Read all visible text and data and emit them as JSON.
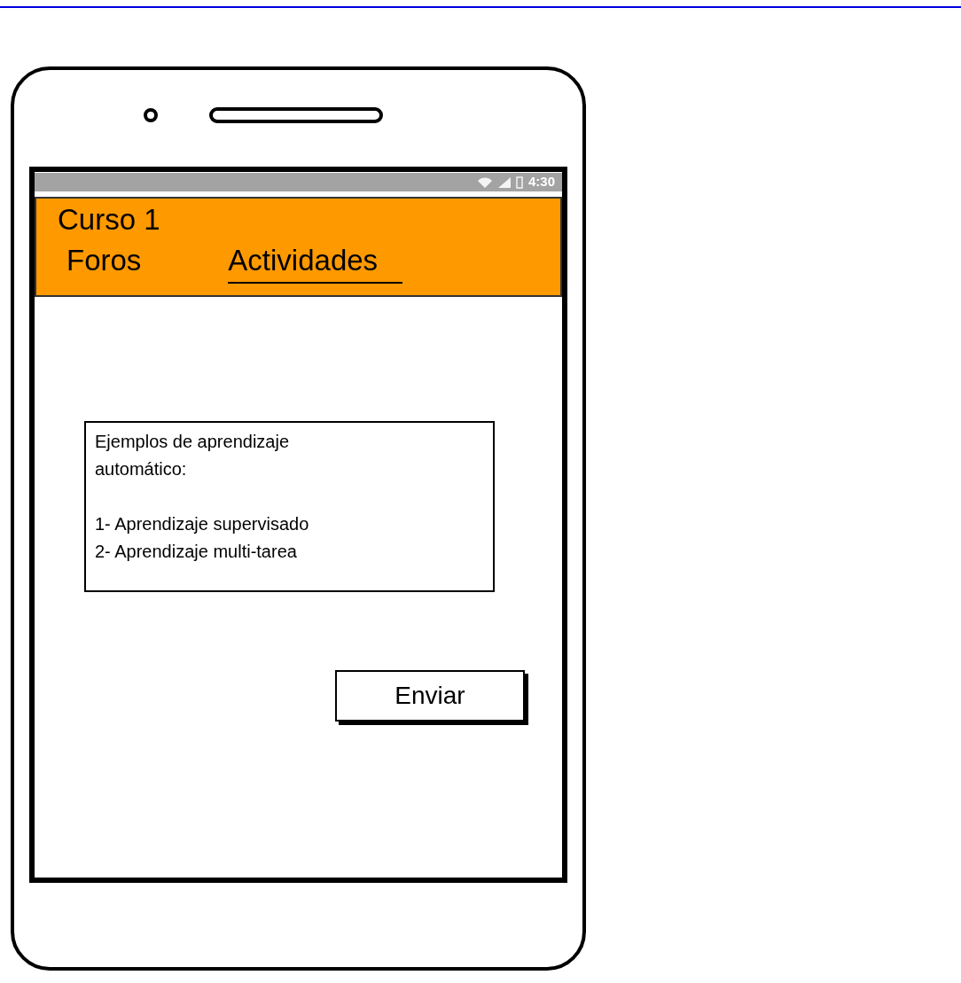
{
  "status_bar": {
    "time": "4:30"
  },
  "header": {
    "title": "Curso 1",
    "tabs": [
      {
        "label": "Foros",
        "selected": false
      },
      {
        "label": "Actividades",
        "selected": true
      }
    ]
  },
  "text_area": {
    "intro": [
      "Ejemplos de aprendizaje",
      "automático:"
    ],
    "items": [
      "1- Aprendizaje supervisado",
      "2- Aprendizaje multi-tarea"
    ]
  },
  "button": {
    "label": "Enviar"
  }
}
